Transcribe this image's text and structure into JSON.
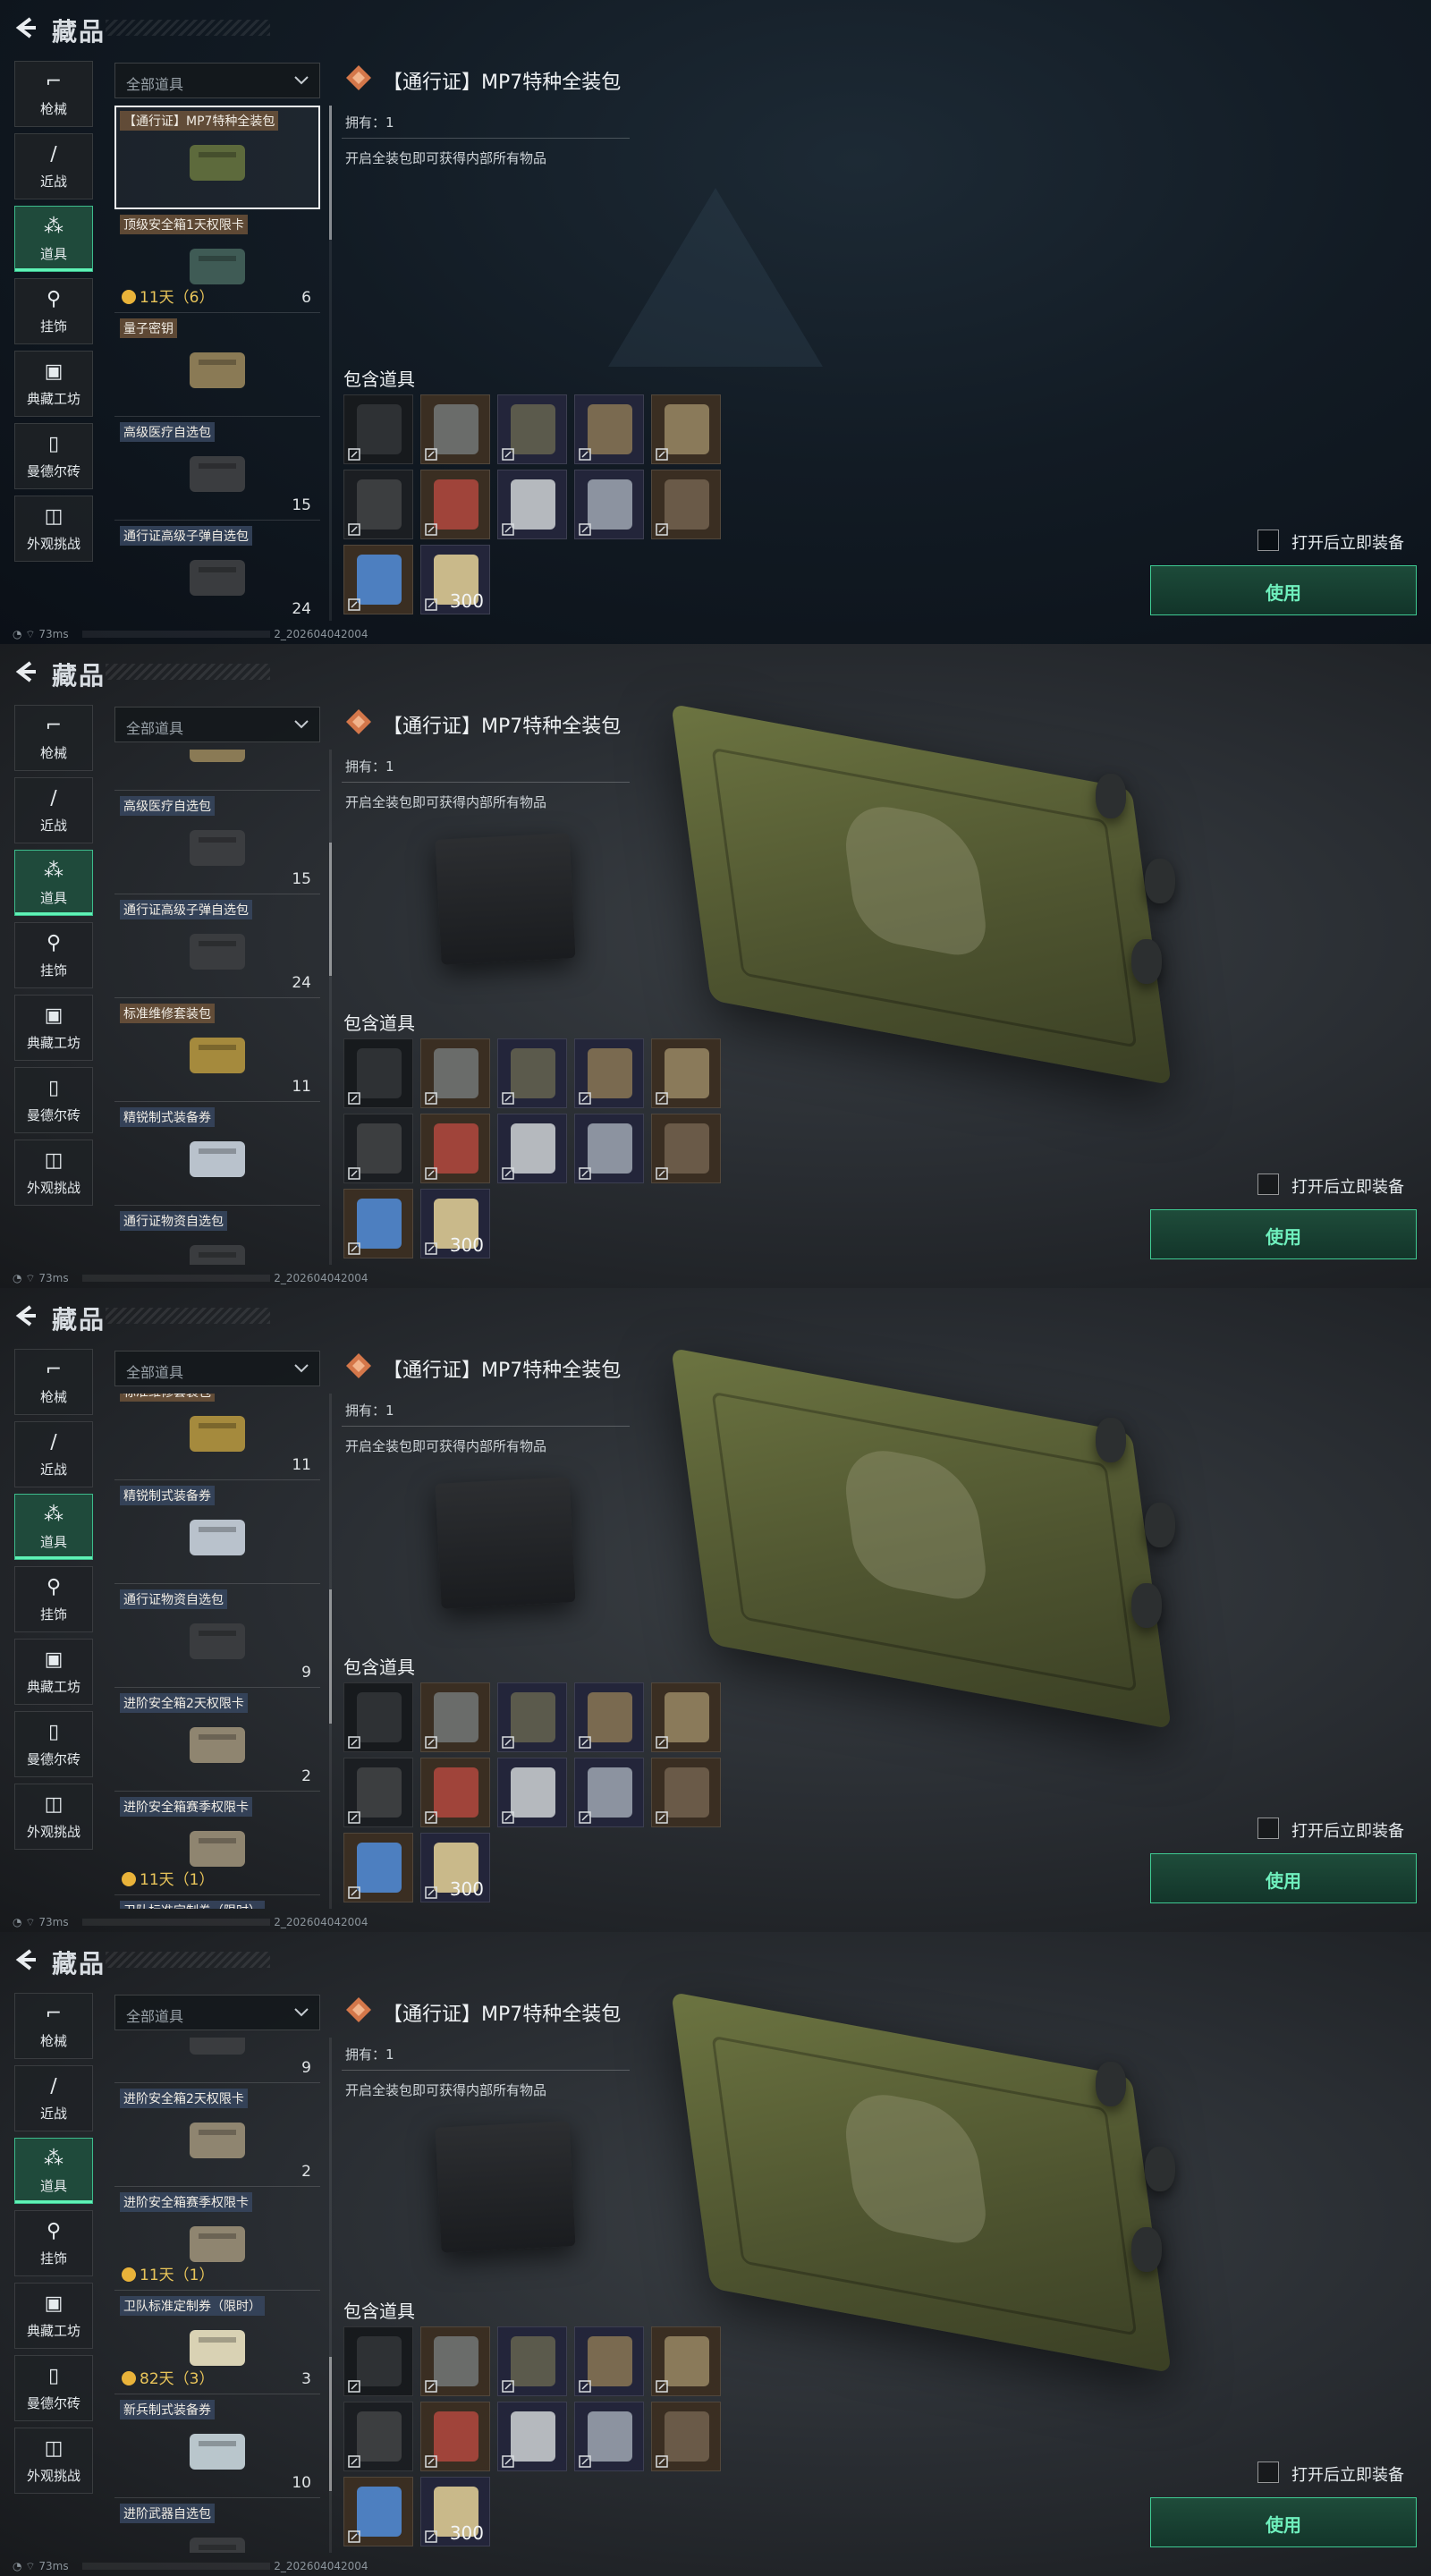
{
  "header": {
    "title": "藏品"
  },
  "nav": [
    {
      "icon": "gun-icon",
      "glyph": "⌐",
      "label": "枪械"
    },
    {
      "icon": "knife-icon",
      "glyph": "∕",
      "label": "近战"
    },
    {
      "icon": "items-icon",
      "glyph": "⁂",
      "label": "道具"
    },
    {
      "icon": "charm-icon",
      "glyph": "⚲",
      "label": "挂饰"
    },
    {
      "icon": "frame-icon",
      "glyph": "▣",
      "label": "典藏工坊"
    },
    {
      "icon": "brick-icon",
      "glyph": "▯",
      "label": "曼德尔砖"
    },
    {
      "icon": "appearance-icon",
      "glyph": "◫",
      "label": "外观挑战"
    }
  ],
  "filter": {
    "value": "全部道具"
  },
  "items": [
    {
      "name": "【通行证】MP7特种全装包",
      "count": "",
      "timer": "",
      "tag": "brown",
      "color": "#5d6a3c"
    },
    {
      "name": "顶级安全箱1天权限卡",
      "count": "6",
      "timer": "11天（6）",
      "tag": "brown",
      "color": "#3f5b55"
    },
    {
      "name": "量子密钥",
      "count": "",
      "timer": "",
      "tag": "brown",
      "color": "#8a7a55"
    },
    {
      "name": "高级医疗自选包",
      "count": "15",
      "timer": "",
      "tag": "blue",
      "color": "#3b3d40"
    },
    {
      "name": "通行证高级子弹自选包",
      "count": "24",
      "timer": "",
      "tag": "blue",
      "color": "#3a3c3f"
    },
    {
      "name": "标准维修套装包",
      "count": "11",
      "timer": "",
      "tag": "brown",
      "color": "#a58a3d"
    },
    {
      "name": "精锐制式装备券",
      "count": "",
      "timer": "",
      "tag": "blue",
      "color": "#b9c2cc"
    },
    {
      "name": "通行证物资自选包",
      "count": "9",
      "timer": "",
      "tag": "blue",
      "color": "#3a3c3f"
    },
    {
      "name": "进阶安全箱2天权限卡",
      "count": "2",
      "timer": "",
      "tag": "blue",
      "color": "#8f8570"
    },
    {
      "name": "进阶安全箱赛季权限卡",
      "count": "",
      "timer": "11天（1）",
      "tag": "blue",
      "color": "#8f8570"
    },
    {
      "name": "卫队标准定制券（限时）",
      "count": "3",
      "timer": "82天（3）",
      "tag": "blue",
      "color": "#d9d2b4"
    },
    {
      "name": "新兵制式装备券",
      "count": "10",
      "timer": "",
      "tag": "blue",
      "color": "#b9c6cc"
    },
    {
      "name": "进阶武器自选包",
      "count": "",
      "timer": "",
      "tag": "blue",
      "color": "#3a3c3f"
    }
  ],
  "views": [
    {
      "variant": "v0",
      "scroll_items": 0,
      "scroll_thumb_start": 0.0,
      "scroll_thumb_len": 0.26
    },
    {
      "variant": "v1",
      "scroll_items": 2.6,
      "scroll_thumb_start": 0.18,
      "scroll_thumb_len": 0.26
    },
    {
      "variant": "v1",
      "scroll_items": 5.16,
      "scroll_thumb_start": 0.38,
      "scroll_thumb_len": 0.26
    },
    {
      "variant": "v1",
      "scroll_items": 7.56,
      "scroll_thumb_start": 0.62,
      "scroll_thumb_len": 0.26
    }
  ],
  "detail": {
    "title": "【通行证】MP7特种全装包",
    "owned": "拥有：1",
    "description": "开启全装包即可获得内部所有物品",
    "contains_label": "包含道具",
    "contents": [
      {
        "icon": "weapon-icon",
        "color": "#2e3134",
        "bg": "#171a1d",
        "qty": ""
      },
      {
        "icon": "backpack-icon",
        "color": "#6a6c6a",
        "bg": "#3a2e22",
        "qty": ""
      },
      {
        "icon": "rig-icon",
        "color": "#5b5a4c",
        "bg": "#23253a",
        "qty": ""
      },
      {
        "icon": "helmet-icon",
        "color": "#7a6a50",
        "bg": "#23253a",
        "qty": ""
      },
      {
        "icon": "vest-icon",
        "color": "#8a7a5a",
        "bg": "#3a2e22",
        "qty": ""
      },
      {
        "icon": "headset-icon",
        "color": "#3c3e40",
        "bg": "#1b1e22",
        "qty": ""
      },
      {
        "icon": "medkit-icon",
        "color": "#a0443a",
        "bg": "#3a2e22",
        "qty": ""
      },
      {
        "icon": "syringe-icon",
        "color": "#b5b9be",
        "bg": "#23253a",
        "qty": ""
      },
      {
        "icon": "card-icon",
        "color": "#8c93a0",
        "bg": "#23253a",
        "qty": ""
      },
      {
        "icon": "armor-plate-icon",
        "color": "#6a5a48",
        "bg": "#3a2e22",
        "qty": ""
      },
      {
        "icon": "battery-icon",
        "color": "#4d7fc0",
        "bg": "#3a2e22",
        "qty": ""
      },
      {
        "icon": "ammo-icon",
        "color": "#c9b98a",
        "bg": "#23253a",
        "qty": "300"
      }
    ]
  },
  "actions": {
    "auto_equip": "打开后立即装备",
    "use": "使用"
  },
  "status": {
    "ping": "73ms",
    "build": "2_202604042004"
  },
  "colors": {
    "accent": "#5ff2b6",
    "timer": "#e9c55a"
  }
}
